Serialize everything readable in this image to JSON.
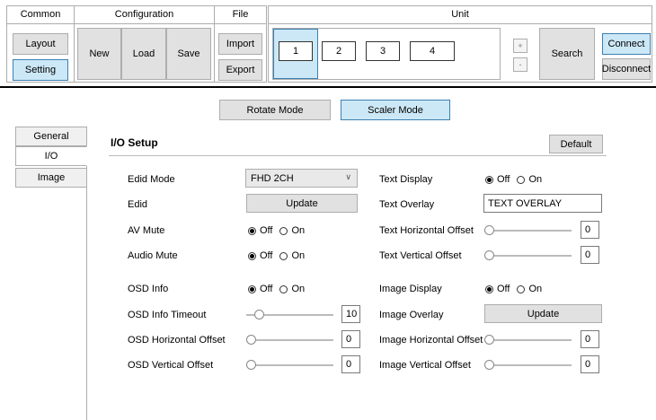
{
  "toolbar": {
    "common": {
      "title": "Common",
      "layout": "Layout",
      "setting": "Setting"
    },
    "configuration": {
      "title": "Configuration",
      "new": "New",
      "load": "Load",
      "save": "Save"
    },
    "file": {
      "title": "File",
      "import": "Import",
      "export": "Export"
    },
    "unit": {
      "title": "Unit",
      "units": [
        "1",
        "2",
        "3",
        "4"
      ],
      "plus": "+",
      "minus": "-",
      "search": "Search",
      "connect": "Connect",
      "disconnect": "Disconnect"
    }
  },
  "modes": {
    "rotate": "Rotate Mode",
    "scaler": "Scaler Mode",
    "selected": "Scaler Mode"
  },
  "tabs": [
    "General",
    "I/O",
    "Image"
  ],
  "active_tab": "I/O",
  "io": {
    "title": "I/O Setup",
    "default": "Default",
    "on": "On",
    "off": "Off",
    "edid_mode": {
      "label": "Edid Mode",
      "value": "FHD 2CH"
    },
    "edid": {
      "label": "Edid",
      "button": "Update"
    },
    "av_mute": {
      "label": "AV Mute",
      "value": "Off"
    },
    "audio_mute": {
      "label": "Audio Mute",
      "value": "Off"
    },
    "osd_info": {
      "label": "OSD Info",
      "value": "Off"
    },
    "osd_info_timeout": {
      "label": "OSD Info Timeout",
      "value": "10"
    },
    "osd_h_offset": {
      "label": "OSD Horizontal Offset",
      "value": "0"
    },
    "osd_v_offset": {
      "label": "OSD Vertical Offset",
      "value": "0"
    },
    "text_display": {
      "label": "Text Display",
      "value": "Off"
    },
    "text_overlay": {
      "label": "Text Overlay",
      "value": "TEXT OVERLAY"
    },
    "text_h_offset": {
      "label": "Text Horizontal Offset",
      "value": "0"
    },
    "text_v_offset": {
      "label": "Text Vertical Offset",
      "value": "0"
    },
    "image_display": {
      "label": "Image Display",
      "value": "Off"
    },
    "image_overlay": {
      "label": "Image Overlay",
      "button": "Update"
    },
    "image_h_offset": {
      "label": "Image Horizontal Offset",
      "value": "0"
    },
    "image_v_offset": {
      "label": "Image Vertical Offset",
      "value": "0"
    }
  },
  "colors": {
    "selected_fill": "#cce8f6",
    "selected_border": "#3c7fb1",
    "button_fill": "#e1e1e1",
    "separator": "#000000"
  }
}
